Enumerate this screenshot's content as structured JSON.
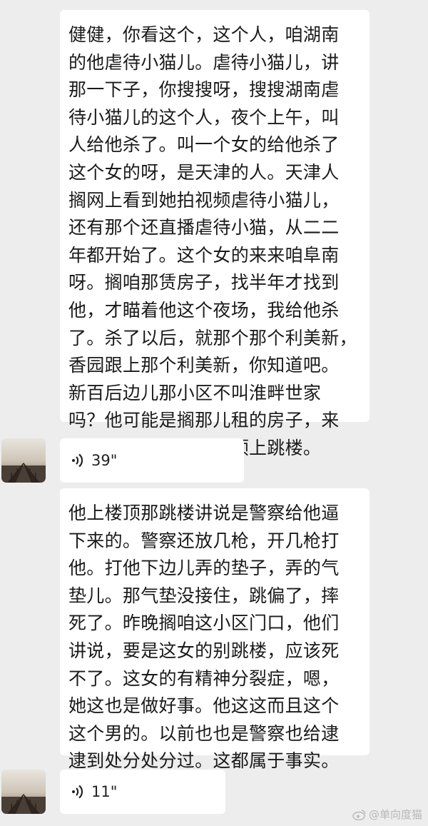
{
  "chat": {
    "messages": [
      {
        "type": "text",
        "text": "健健，你看这个，这个人，咱湖南\n的他虐待小猫儿。虐待小猫儿，讲\n那一下子，你搜搜呀，搜搜湖南虐\n待小猫儿的这个人，夜个上午，叫\n人给他杀了。叫一个女的给他杀了\n这个女的呀，是天津的人。天津人\n搁网上看到她拍视频虐待小猫儿，\n还有那个还直播虐待小猫，从二二\n年都开始了。这个女的来来咱阜南\n呀。搁咱那赁房子，找半年才找到\n他，才瞄着他这个夜场，我给他杀\n了。杀了以后，就那个那个利美新，\n香园跟上那个利美新，你知道吧。\n新百后边儿那小区不叫淮畔世家\n吗？他可能是搁那儿租的房子，来\n这半年了，他就上楼顶上跳楼。"
      },
      {
        "type": "voice",
        "duration": "39\"",
        "avatar_icon": "pier-sunset-icon"
      },
      {
        "type": "text",
        "text": "他上楼顶那跳楼讲说是警察给他逼\n下来的。警察还放几枪，开几枪打\n他。打他下边儿弄的垫子，弄的气\n垫儿。那气垫没接住，跳偏了，摔\n死了。昨晚搁咱这小区门口，他们\n讲说，要是这女的别跳楼，应该死\n不了。这女的有精神分裂症，嗯，\n她这也是做好事。他这这而且这个\n这个男的。以前也也是警察也给逮\n逮到处分处分过。这都属于事实。"
      },
      {
        "type": "voice",
        "duration": "11\"",
        "avatar_icon": "pier-sunset-icon"
      }
    ]
  },
  "watermark": {
    "text": "@单向度猫",
    "icon": "weibo-icon"
  },
  "colors": {
    "background": "#ededed",
    "bubble": "#ffffff",
    "text": "#1a1a1a",
    "watermark": "#b8b8b8"
  }
}
